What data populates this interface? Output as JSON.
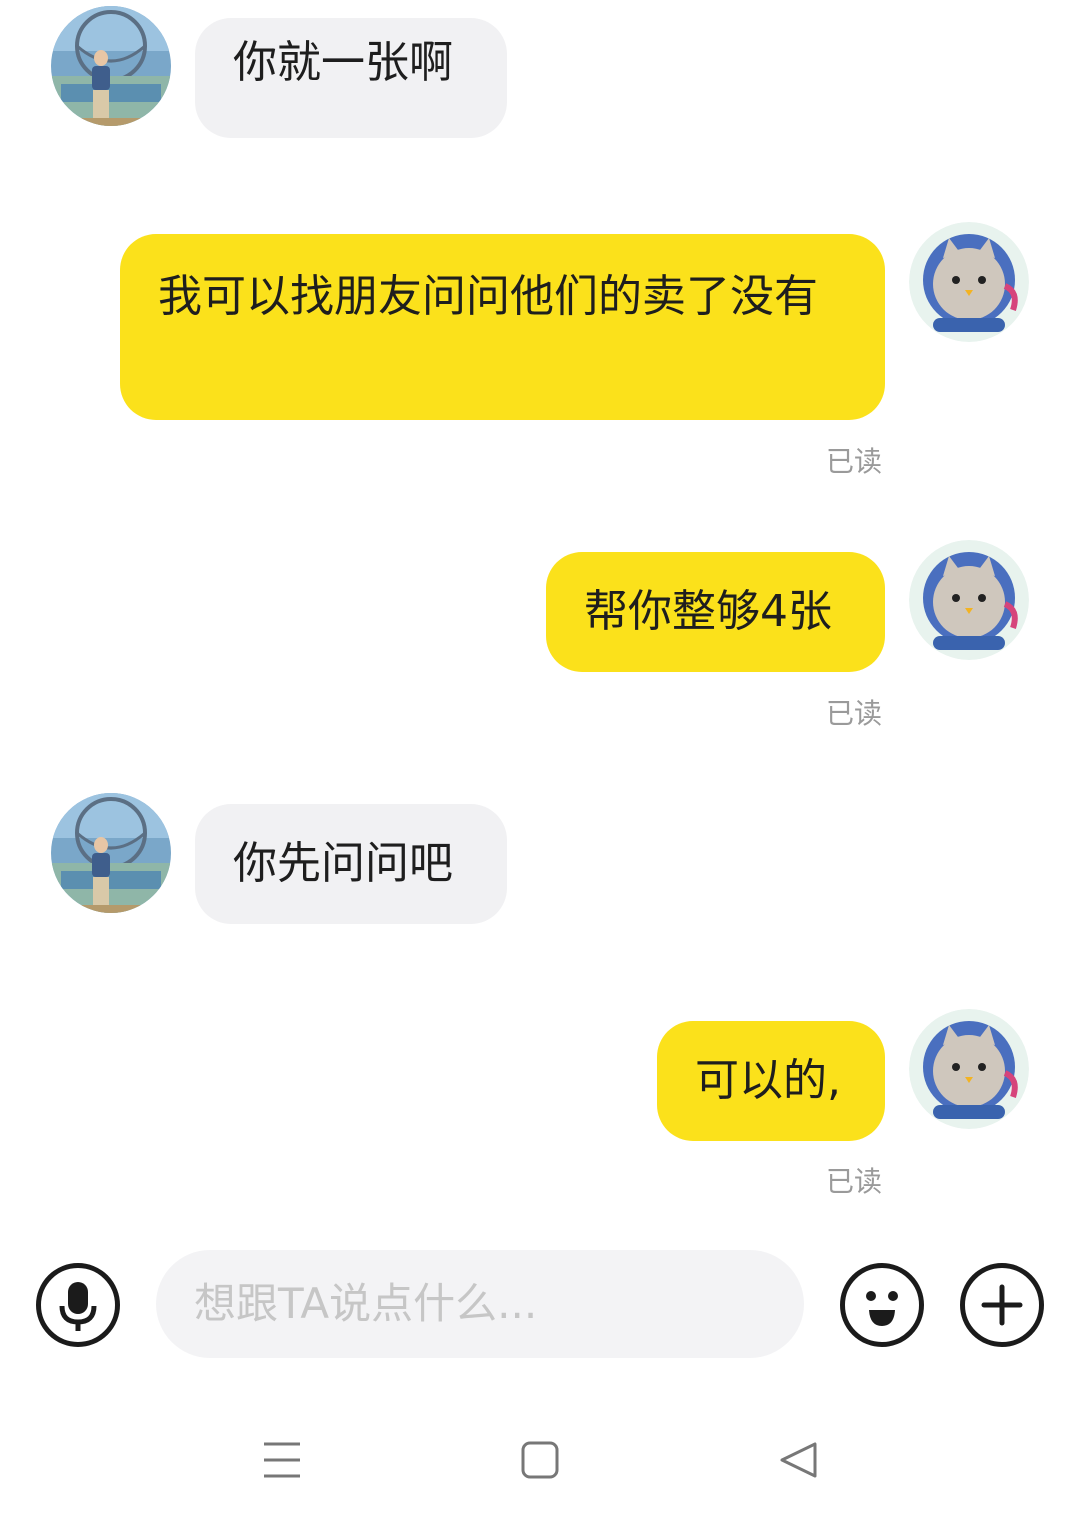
{
  "messages": [
    {
      "side": "in",
      "text": "你就一张啊"
    },
    {
      "side": "out",
      "text": "我可以找朋友问问他们的卖了没有",
      "status": "已读"
    },
    {
      "side": "out",
      "text": "帮你整够4张",
      "status": "已读"
    },
    {
      "side": "in",
      "text": "你先问问吧"
    },
    {
      "side": "out",
      "text": "可以的,",
      "status": "已读"
    }
  ],
  "input": {
    "placeholder": "想跟TA说点什么..."
  },
  "icons": {
    "voice": "microphone-icon",
    "emoji": "smiley-icon",
    "more": "plus-icon",
    "nav_menu": "menu-icon",
    "nav_home": "square-icon",
    "nav_back": "back-triangle-icon"
  },
  "colors": {
    "outgoing": "#fbe11b",
    "incoming": "#f1f1f3"
  }
}
